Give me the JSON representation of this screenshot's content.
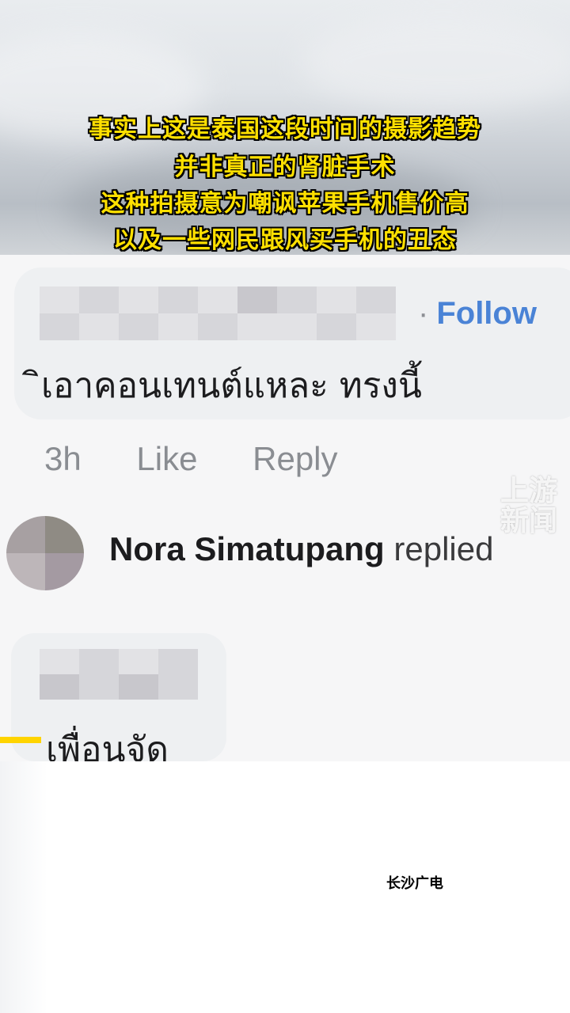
{
  "subtitles": [
    "事实上这是泰国这段时间的摄影趋势",
    "并非真正的肾脏手术",
    "这种拍摄意为嘲讽苹果手机售价高",
    "以及一些网民跟风买手机的丑态"
  ],
  "comment": {
    "follow_label": "Follow",
    "separator": "·",
    "text": "ิเอาคอนเทนต์แหละ ทรงนี้",
    "time": "3h",
    "like_label": "Like",
    "reply_label": "Reply"
  },
  "reply_notice": {
    "name": "Nora Simatupang",
    "action": "replied"
  },
  "reply_comment": {
    "text": "เพื่อนจัด"
  },
  "watermark": {
    "line1": "上游",
    "line2": "新闻"
  },
  "station_label": "长沙广电",
  "colors": {
    "subtitle": "#ffe000",
    "follow": "#4a83d6",
    "accent_bar": "#ffd400"
  }
}
